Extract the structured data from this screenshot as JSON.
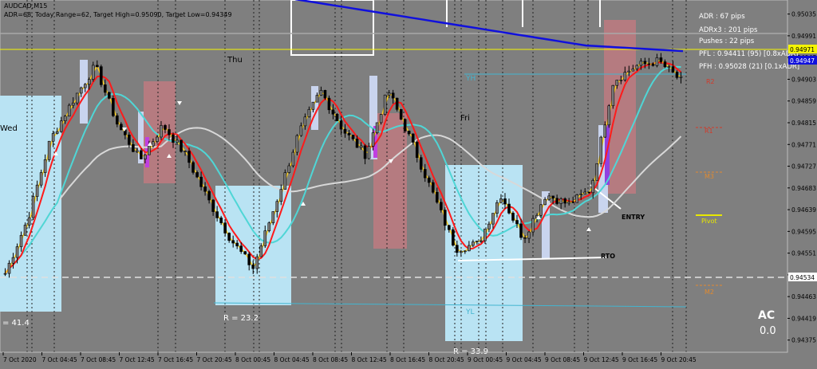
{
  "header": {
    "symbol": "AUDCAD,M15",
    "stats": "ADR=68, Today Range=62, Target High=0.95090, Target Low=0.94349"
  },
  "info_panel": [
    "ADR : 67 pips",
    "ADRx3 : 201 pips",
    "Pushes : 22 pips",
    "PFL : 0.94411 (95) [0.8xADR]",
    "PFH : 0.95028 (21) [0.1xADR]"
  ],
  "colors": {
    "background": "#7f7f7f",
    "bull_candle": "#000000",
    "bear_candle": "#000000",
    "sma_red": "#ff1a1a",
    "sma_yellow": "#ffd21f",
    "sma_cyan": "#4fd6d6",
    "sma_white": "#d8d8d8",
    "sma_blue": "#1010dd",
    "zone_lightblue": "#b9e3f3",
    "zone_red": "#b57b80",
    "price_line": "#f4f400"
  },
  "labels": {
    "day_wed": "Wed",
    "day_thu": "Thu",
    "day_fri": "Fri",
    "range_1": "= 41.4",
    "range_2": "R = 23.2",
    "range_3": "R = 33.9",
    "yh": "YH",
    "yl": "YL",
    "entry": "ENTRY",
    "rto": "RTO",
    "r1": "R1",
    "r2": "R2",
    "m3": "M3",
    "m2": "M2",
    "pivot": "Pivot",
    "ac_title": "AC",
    "ac_value": "0.0"
  },
  "chart_data": {
    "type": "candlestick",
    "y_ticks": [
      "0.95035",
      "0.94991",
      "0.94947",
      "0.94903",
      "0.94859",
      "0.94815",
      "0.94771",
      "0.94727",
      "0.94683",
      "0.94639",
      "0.94595",
      "0.94551",
      "0.94507",
      "0.94463",
      "0.94419",
      "0.94375"
    ],
    "y_ticks_shown": [
      "0.95035",
      "0.94991",
      "0.94947",
      "0.94903",
      "0.94859",
      "0.94815",
      "0.94771",
      "0.94727",
      "0.94683",
      "0.94639",
      "0.94595",
      "0.94551",
      "0.94507",
      "0.94463",
      "0.94419",
      "0.94375"
    ],
    "price_labels": [
      "0.94971",
      "0.94947",
      "0.94534"
    ],
    "x_tick_labels": [
      "7 Oct 2020",
      "7 Oct 04:45",
      "7 Oct 08:45",
      "7 Oct 12:45",
      "7 Oct 16:45",
      "7 Oct 20:45",
      "8 Oct 00:45",
      "8 Oct 04:45",
      "8 Oct 08:45",
      "8 Oct 12:45",
      "8 Oct 16:45",
      "8 Oct 20:45",
      "9 Oct 00:45",
      "9 Oct 04:45",
      "9 Oct 08:45",
      "9 Oct 12:45",
      "9 Oct 16:45",
      "9 Oct 20:45"
    ],
    "ylim": [
      0.9436,
      0.95057
    ],
    "close_path": [
      0.9451,
      0.9462,
      0.9478,
      0.9486,
      0.9493,
      0.9481,
      0.9474,
      0.9481,
      0.9475,
      0.9466,
      0.9458,
      0.9452,
      0.9465,
      0.9479,
      0.9488,
      0.948,
      0.9475,
      0.9488,
      0.9478,
      0.9467,
      0.9456,
      0.9457,
      0.9467,
      0.9458,
      0.9467,
      0.9465,
      0.9468,
      0.949,
      0.9493,
      0.9494,
      0.949
    ],
    "reference_lines": {
      "yellow_price": 0.94971,
      "blue_price": 0.94947,
      "dashed_white": 0.94534
    }
  }
}
